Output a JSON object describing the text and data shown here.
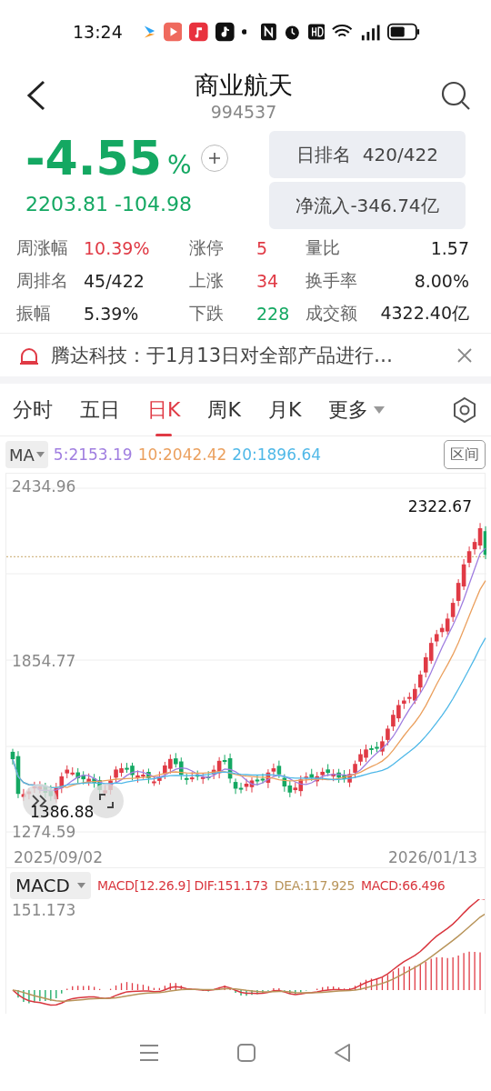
{
  "status_bar": {
    "time": "13:24"
  },
  "header": {
    "title": "商业航天",
    "code": "994537"
  },
  "quote": {
    "change_pct": "-4.55",
    "pct_sign": "%",
    "price": "2203.81",
    "change": "-104.98"
  },
  "daily_rank": {
    "label": "日排名",
    "value": "420/422"
  },
  "net_inflow": {
    "text": "净流入-346.74亿"
  },
  "stats": [
    {
      "label": "周涨幅",
      "value": "10.39%",
      "color": "#e03a45"
    },
    {
      "label": "涨停",
      "value": "5",
      "color": "#e03a45"
    },
    {
      "label": "量比",
      "value": "1.57",
      "color": "#222222"
    },
    {
      "label": "周排名",
      "value": "45/422",
      "color": "#222222"
    },
    {
      "label": "上涨",
      "value": "34",
      "color": "#e03a45"
    },
    {
      "label": "换手率",
      "value": "8.00%",
      "color": "#222222"
    },
    {
      "label": "振幅",
      "value": "5.39%",
      "color": "#222222"
    },
    {
      "label": "下跌",
      "value": "228",
      "color": "#14a862"
    },
    {
      "label": "成交额",
      "value": "4322.40亿",
      "color": "#222222"
    }
  ],
  "notice": {
    "text": "腾达科技：于1月13日对全部产品进行…"
  },
  "tabs": [
    {
      "label": "分时",
      "selected": false
    },
    {
      "label": "五日",
      "selected": false
    },
    {
      "label": "日K",
      "selected": true
    },
    {
      "label": "周K",
      "selected": false
    },
    {
      "label": "月K",
      "selected": false
    }
  ],
  "more_tab": {
    "label": "更多"
  },
  "ma": {
    "label": "MA",
    "lines": [
      {
        "text": "5:2153.19",
        "color": "#a07ee0"
      },
      {
        "text": "10:2042.42",
        "color": "#eba05e"
      },
      {
        "text": "20:1896.64",
        "color": "#4fb8e8"
      }
    ],
    "range_button": "区间"
  },
  "kline": {
    "y_labels": [
      "2434.96",
      "1854.77",
      "1274.59"
    ],
    "high_label": "2322.67",
    "low_label": "1386.88",
    "start_date": "2025/09/02",
    "end_date": "2026/01/13"
  },
  "macd": {
    "label": "MACD",
    "params": [
      {
        "text": "MACD[12.26.9] DIF:151.173",
        "color": "#d9363e"
      },
      {
        "text": "DEA:117.925",
        "color": "#b8945a"
      },
      {
        "text": "MACD:66.496",
        "color": "#d9363e"
      }
    ],
    "top_label": "151.173"
  }
}
